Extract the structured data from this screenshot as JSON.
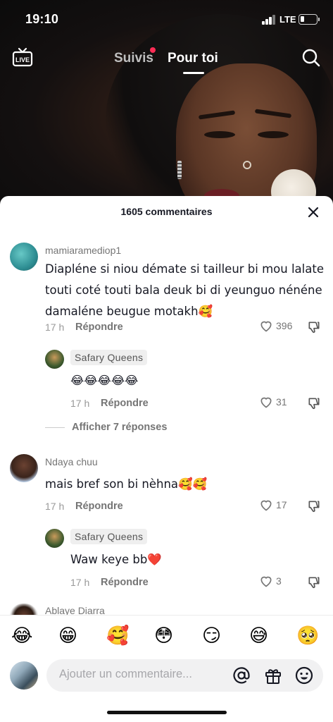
{
  "status_bar": {
    "time": "19:10",
    "network": "LTE"
  },
  "top_nav": {
    "live_label": "LIVE",
    "tabs": [
      {
        "label": "Suivis",
        "has_notification_dot": true
      },
      {
        "label": "Pour toi",
        "active": true
      }
    ]
  },
  "comments_sheet": {
    "title": "1605 commentaires",
    "comments": [
      {
        "username": "mamiaramediop1",
        "text_lines": [
          "Diapléne si niou démate si tailleur bi mou lalate",
          "touti coté touti bala deuk bi di yeunguo nénéne",
          "damaléne beugue motakh🥰"
        ],
        "time": "17 h",
        "reply_label": "Répondre",
        "likes": "396",
        "replies": [
          {
            "username": "Safary Queens",
            "text": "😂😂😂😂😂",
            "time": "17 h",
            "reply_label": "Répondre",
            "likes": "31"
          }
        ],
        "view_replies_label": "Afficher 7 réponses"
      },
      {
        "username": "Ndaya chuu",
        "text_lines": [
          "mais bref son bi nèhna🥰🥰"
        ],
        "time": "17 h",
        "reply_label": "Répondre",
        "likes": "17",
        "replies": [
          {
            "username": "Safary Queens",
            "text": "Waw keye bb❤️",
            "time": "17 h",
            "reply_label": "Répondre",
            "likes": "3"
          }
        ]
      },
      {
        "username": "Ablaye Diarra"
      }
    ],
    "quick_emojis": [
      "😂",
      "😁",
      "🥰",
      "😳",
      "😏",
      "😅",
      "🥺"
    ],
    "input": {
      "placeholder": "Ajouter un commentaire..."
    }
  },
  "icons": {
    "live": "live-tv-icon",
    "search": "search-icon",
    "close": "close-icon",
    "like": "heart-outline-icon",
    "dislike": "thumbs-down-icon",
    "mention": "at-sign-icon",
    "gift": "gift-icon",
    "emoji": "smiley-icon"
  },
  "colors": {
    "accent_red": "#fe2c55",
    "text_primary": "#161823",
    "text_secondary": "#757575"
  }
}
